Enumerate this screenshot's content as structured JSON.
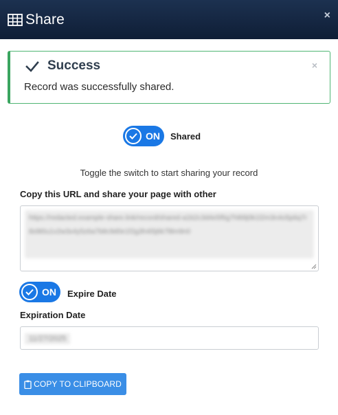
{
  "header": {
    "title": "Share",
    "close_glyph": "×",
    "icon": "table-icon"
  },
  "alert": {
    "title": "Success",
    "message": "Record was successfully shared.",
    "close_glyph": "×",
    "icon": "check-icon",
    "accent_color": "#3aa55f"
  },
  "shared_toggle": {
    "state_text": "ON",
    "label": "Shared",
    "on": true
  },
  "hint": "Toggle the switch to start sharing your record",
  "url_section": {
    "label": "Copy this URL and share your page with other",
    "value": "https://redacted.example-share.link/record/shared-a1b2c3d4e5f6g7h8i9j0k1l2m3n4o5p6q7r8s9t0u1v2w3x4y5z6a7b8c9d0e1f2g3h4i5j6k7l8m9n0"
  },
  "expire_toggle": {
    "state_text": "ON",
    "label": "Expire Date",
    "on": true
  },
  "expiration": {
    "label": "Expiration Date",
    "value": "11/27/2025"
  },
  "copy_button": {
    "label": "COPY TO CLIPBOARD",
    "icon": "clipboard-icon"
  },
  "colors": {
    "header_bg": "#0f1e36",
    "toggle_blue": "#1a78e5",
    "button_blue": "#3a8ee6",
    "success_green": "#3aa55f"
  }
}
